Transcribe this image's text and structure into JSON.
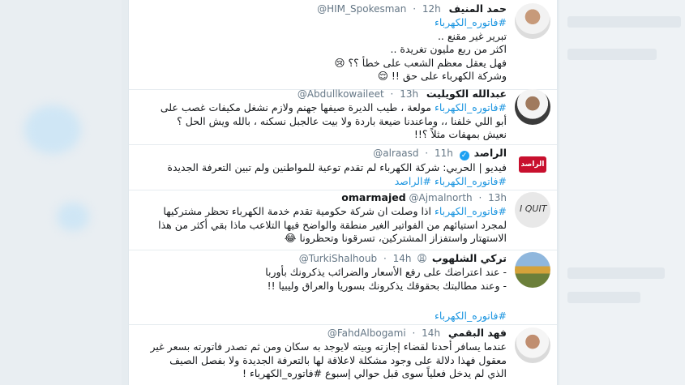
{
  "colors": {
    "hashtag": "#1b95e0",
    "verified": "#1da1f2"
  },
  "tweets": [
    {
      "name": "حمد المنيف",
      "handle": "@HIM_Spokesman",
      "time": "12h",
      "verified": false,
      "lines": [
        "#فاتوره_الكهرباء",
        "تبرير غير مقنع ..",
        "اكثر من ربع مليون تغريدة ..",
        "فهل يعقل معظم الشعب على خطأ ؟؟ 😢",
        "وشركة الكهرباء على حق !! 😌"
      ]
    },
    {
      "name": "عبدالله الكويليت",
      "handle": "@Abdullkowaileet",
      "time": "13h",
      "verified": false,
      "hashtag_inline": "#فاتوره_الكهرباء",
      "lines": [
        "مولعة ، طيب الديرة صيفها جهنم ولازم نشغل مكيفات غصب على",
        "أبو اللي خلفنا ،، وماعندنا ضيعة باردة ولا بيت عالجبل نسكنه ، بالله ويش الحل ؟",
        "نعيش بمهفات مثلاً ؟!!"
      ]
    },
    {
      "name": "الراصد",
      "handle": "@alraasd",
      "time": "11h",
      "verified": true,
      "lines": [
        "فيديو | الحربي: شركة الكهرباء لم تقدم توعية للمواطنين ولم تبين التعرفة الجديدة",
        "#فاتوره_الكهرباء #الراصد"
      ]
    },
    {
      "name": "omarmajed",
      "handle": "@Ajmalnorth",
      "time": "13h",
      "verified": false,
      "hashtag_inline": "#فاتوره_الكهرباء",
      "lines": [
        "اذا وصلت ان شركة حكومية تقدم خدمة الكهرباء تحظر مشتركيها",
        "لمجرد استيائهم من الفواتير الغير منطقة والواضح فيها التلاعب ماذا بقي أكثر من هذا",
        "الاستهتار واستفزاز المشتركين، تسرقونا وتحظرونا 😂"
      ]
    },
    {
      "name": "تركي الشلهوب",
      "handle": "@TurkiShalhoub",
      "time": "14h",
      "verified": false,
      "name_emoji": "😩",
      "lines": [
        "- عند اعتراضك على رفع الأسعار والضرائب يذكرونك بأوربا",
        "- وعند مطالبتك بحقوقك يذكرونك بسوريا والعراق وليبيا  !!"
      ],
      "tail": "#فاتوره_الكهرباء"
    },
    {
      "name": "فهد البقمي",
      "handle": "@FahdAlbogami",
      "time": "14h",
      "verified": false,
      "lines": [
        "عندما يسافر أحدنا لقضاء إجازته وبيته لايوجد به سكان ومن ثم تصدر فاتورته بسعر غير",
        "معقول فهذا دلالة على وجود مشكلة لاعلاقة لها بالتعرفة الجديدة ولا بفصل الصيف",
        "الذي لم يدخل فعلياً سوى قبل حوالي إسبوع #فاتوره_الكهرباء !"
      ]
    }
  ]
}
